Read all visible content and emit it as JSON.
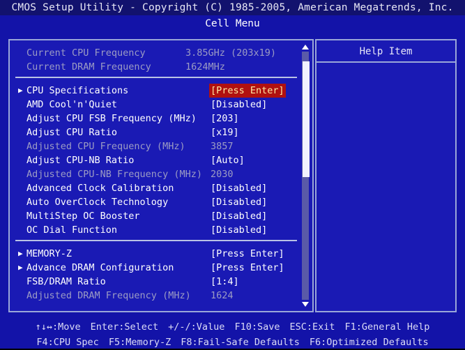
{
  "header": {
    "title": "CMOS Setup Utility - Copyright (C) 1985-2005, American Megatrends, Inc.",
    "subtitle": "Cell Menu"
  },
  "help_panel": {
    "title": "Help Item",
    "content": ""
  },
  "colors": {
    "background": "#1313a8",
    "panel": "#1a1ab4",
    "border": "#9aa6d8",
    "text": "#ffffff",
    "dim_text": "#9c9cc4",
    "selection_bg": "#b01010",
    "selection_text": "#ffe8a0"
  },
  "scrollbar": {
    "up_arrow": "triangle-up-icon",
    "down_arrow": "triangle-down-icon",
    "thumb_position_percent": 0
  },
  "menu": {
    "status_rows": [
      {
        "label": "Current CPU Frequency",
        "value": "3.85GHz (203x19)",
        "dim": true
      },
      {
        "label": "Current DRAM Frequency",
        "value": "1624MHz",
        "dim": true
      }
    ],
    "group_one": [
      {
        "label": "CPU Specifications",
        "value": "[Press Enter]",
        "arrow": true,
        "selected": true,
        "dim": false
      },
      {
        "label": "AMD Cool'n'Quiet",
        "value": "[Disabled]",
        "arrow": false,
        "selected": false,
        "dim": false
      },
      {
        "label": "Adjust CPU FSB Frequency (MHz)",
        "value": "[203]",
        "arrow": false,
        "selected": false,
        "dim": false
      },
      {
        "label": "Adjust CPU Ratio",
        "value": "[x19]",
        "arrow": false,
        "selected": false,
        "dim": false
      },
      {
        "label": "Adjusted CPU Frequency (MHz)",
        "value": "3857",
        "arrow": false,
        "selected": false,
        "dim": true
      },
      {
        "label": "Adjust CPU-NB Ratio",
        "value": "[Auto]",
        "arrow": false,
        "selected": false,
        "dim": false
      },
      {
        "label": "Adjusted CPU-NB Frequency (MHz)",
        "value": "2030",
        "arrow": false,
        "selected": false,
        "dim": true
      },
      {
        "label": "Advanced Clock Calibration",
        "value": "[Disabled]",
        "arrow": false,
        "selected": false,
        "dim": false
      },
      {
        "label": "Auto OverClock Technology",
        "value": "[Disabled]",
        "arrow": false,
        "selected": false,
        "dim": false
      },
      {
        "label": "MultiStep OC Booster",
        "value": "[Disabled]",
        "arrow": false,
        "selected": false,
        "dim": false
      },
      {
        "label": "OC Dial Function",
        "value": "[Disabled]",
        "arrow": false,
        "selected": false,
        "dim": false
      }
    ],
    "group_two": [
      {
        "label": "MEMORY-Z",
        "value": "[Press Enter]",
        "arrow": true,
        "selected": false,
        "dim": false
      },
      {
        "label": "Advance DRAM Configuration",
        "value": "[Press Enter]",
        "arrow": true,
        "selected": false,
        "dim": false
      },
      {
        "label": "FSB/DRAM Ratio",
        "value": "[1:4]",
        "arrow": false,
        "selected": false,
        "dim": false
      },
      {
        "label": "Adjusted DRAM Frequency (MHz)",
        "value": "1624",
        "arrow": false,
        "selected": false,
        "dim": true
      }
    ]
  },
  "footer": {
    "line1": [
      "↑↓↔:Move",
      "Enter:Select",
      "+/-/:Value",
      "F10:Save",
      "ESC:Exit",
      "F1:General Help"
    ],
    "line2": [
      "F4:CPU Spec",
      "F5:Memory-Z",
      "F8:Fail-Safe Defaults",
      "F6:Optimized Defaults"
    ]
  }
}
